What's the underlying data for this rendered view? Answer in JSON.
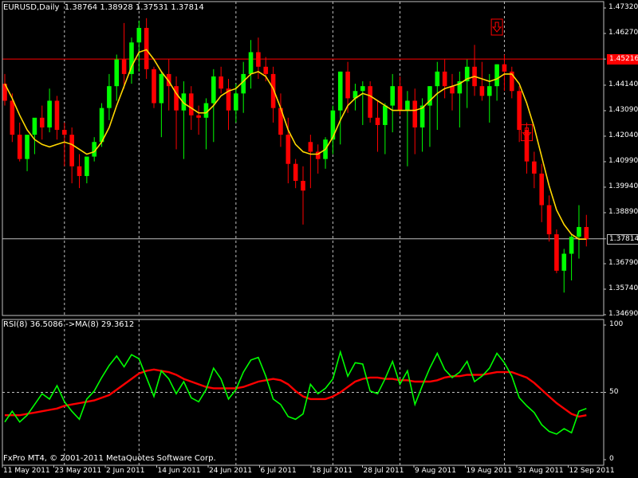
{
  "chart_data": [
    {
      "type": "candlestick",
      "symbol_label": "EURUSD,Daily",
      "ohlc_header": "1.38764 1.38928 1.37531 1.37814",
      "y_ticks": [
        "1.47320",
        "1.46270",
        "1.45216",
        "1.44140",
        "1.43090",
        "1.42040",
        "1.40990",
        "1.39940",
        "1.38890",
        "1.37814",
        "1.36790",
        "1.35740",
        "1.34690"
      ],
      "ylim": [
        1.3469,
        1.4732
      ],
      "horizontal_lines": [
        {
          "price": 1.45216,
          "label": "1.45216",
          "color": "#ff0000"
        },
        {
          "price": 1.37814,
          "label": "1.37814",
          "color": "#c0c0c0"
        }
      ],
      "x_labels": [
        "11 May 2011",
        "23 May 2011",
        "2 Jun 2011",
        "14 Jun 2011",
        "24 Jun 2011",
        "6 Jul 2011",
        "18 Jul 2011",
        "28 Jul 2011",
        "9 Aug 2011",
        "19 Aug 2011",
        "31 Aug 2011",
        "12 Sep 2011"
      ],
      "series": [
        {
          "name": "candles",
          "colors": {
            "up": "#00ff00",
            "down": "#ff0000"
          },
          "open": [
            1.442,
            1.435,
            1.421,
            1.411,
            1.421,
            1.428,
            1.424,
            1.435,
            1.423,
            1.421,
            1.408,
            1.404,
            1.412,
            1.418,
            1.432,
            1.441,
            1.452,
            1.446,
            1.459,
            1.465,
            1.448,
            1.434,
            1.446,
            1.441,
            1.431,
            1.438,
            1.429,
            1.428,
            1.434,
            1.445,
            1.44,
            1.431,
            1.438,
            1.446,
            1.455,
            1.449,
            1.446,
            1.432,
            1.421,
            1.409,
            1.402,
            1.418,
            1.414,
            1.411,
            1.419,
            1.431,
            1.447,
            1.436,
            1.439,
            1.441,
            1.428,
            1.425,
            1.433,
            1.441,
            1.431,
            1.435,
            1.424,
            1.433,
            1.441,
            1.447,
            1.441,
            1.438,
            1.443,
            1.449,
            1.441,
            1.437,
            1.441,
            1.45,
            1.447,
            1.439,
            1.423,
            1.41,
            1.405,
            1.392,
            1.38,
            1.365,
            1.372,
            1.379,
            1.383
          ],
          "high": [
            1.446,
            1.438,
            1.426,
            1.416,
            1.424,
            1.433,
            1.44,
            1.437,
            1.426,
            1.424,
            1.413,
            1.407,
            1.42,
            1.434,
            1.446,
            1.454,
            1.467,
            1.461,
            1.468,
            1.469,
            1.449,
            1.447,
            1.452,
            1.445,
            1.443,
            1.441,
            1.433,
            1.436,
            1.448,
            1.449,
            1.444,
            1.442,
            1.451,
            1.46,
            1.461,
            1.453,
            1.449,
            1.438,
            1.428,
            1.411,
            1.408,
            1.421,
            1.417,
            1.42,
            1.433,
            1.447,
            1.451,
            1.442,
            1.443,
            1.443,
            1.435,
            1.434,
            1.446,
            1.445,
            1.439,
            1.44,
            1.436,
            1.441,
            1.451,
            1.452,
            1.446,
            1.447,
            1.452,
            1.458,
            1.451,
            1.446,
            1.45,
            1.454,
            1.449,
            1.441,
            1.426,
            1.414,
            1.409,
            1.396,
            1.382,
            1.374,
            1.38,
            1.392,
            1.388
          ],
          "low": [
            1.433,
            1.418,
            1.41,
            1.406,
            1.413,
            1.419,
            1.422,
            1.419,
            1.408,
            1.401,
            1.399,
            1.401,
            1.41,
            1.416,
            1.427,
            1.435,
            1.44,
            1.442,
            1.447,
            1.444,
            1.432,
            1.42,
            1.431,
            1.415,
            1.411,
            1.423,
            1.421,
            1.415,
            1.418,
            1.438,
            1.423,
            1.426,
            1.43,
            1.44,
            1.444,
            1.443,
            1.426,
            1.416,
            1.401,
            1.399,
            1.384,
            1.399,
            1.405,
            1.407,
            1.413,
            1.417,
            1.43,
            1.431,
            1.425,
            1.426,
            1.414,
            1.413,
            1.422,
            1.429,
            1.408,
            1.413,
            1.414,
            1.416,
            1.423,
            1.436,
            1.431,
            1.424,
            1.432,
            1.437,
            1.435,
            1.426,
            1.435,
            1.439,
            1.436,
            1.418,
            1.405,
            1.399,
            1.385,
            1.377,
            1.364,
            1.356,
            1.361,
            1.37,
            1.375
          ],
          "close": [
            1.435,
            1.421,
            1.411,
            1.421,
            1.428,
            1.424,
            1.435,
            1.423,
            1.421,
            1.408,
            1.404,
            1.412,
            1.418,
            1.432,
            1.441,
            1.452,
            1.446,
            1.459,
            1.465,
            1.448,
            1.434,
            1.446,
            1.441,
            1.431,
            1.438,
            1.429,
            1.428,
            1.434,
            1.445,
            1.44,
            1.431,
            1.438,
            1.446,
            1.455,
            1.449,
            1.446,
            1.432,
            1.421,
            1.409,
            1.402,
            1.398,
            1.414,
            1.411,
            1.419,
            1.431,
            1.447,
            1.436,
            1.439,
            1.441,
            1.428,
            1.425,
            1.433,
            1.441,
            1.431,
            1.435,
            1.424,
            1.433,
            1.441,
            1.447,
            1.441,
            1.438,
            1.443,
            1.449,
            1.441,
            1.437,
            1.441,
            1.45,
            1.447,
            1.439,
            1.423,
            1.41,
            1.405,
            1.392,
            1.38,
            1.365,
            1.372,
            1.379,
            1.383,
            1.378
          ]
        },
        {
          "name": "moving-average",
          "color": "#ffd700",
          "values": [
            1.442,
            1.436,
            1.429,
            1.423,
            1.419,
            1.417,
            1.416,
            1.417,
            1.418,
            1.417,
            1.415,
            1.413,
            1.414,
            1.418,
            1.424,
            1.433,
            1.441,
            1.449,
            1.455,
            1.456,
            1.452,
            1.447,
            1.443,
            1.438,
            1.434,
            1.432,
            1.43,
            1.43,
            1.433,
            1.437,
            1.439,
            1.44,
            1.443,
            1.446,
            1.447,
            1.445,
            1.44,
            1.432,
            1.423,
            1.417,
            1.414,
            1.413,
            1.413,
            1.415,
            1.42,
            1.427,
            1.433,
            1.436,
            1.438,
            1.437,
            1.435,
            1.433,
            1.431,
            1.431,
            1.431,
            1.431,
            1.432,
            1.435,
            1.438,
            1.44,
            1.441,
            1.442,
            1.444,
            1.445,
            1.444,
            1.443,
            1.444,
            1.446,
            1.446,
            1.442,
            1.434,
            1.424,
            1.412,
            1.4,
            1.39,
            1.384,
            1.38,
            1.378,
            1.378
          ]
        }
      ],
      "arrow_markers": [
        {
          "index": 66,
          "price": 1.465
        },
        {
          "index": 70,
          "price": 1.4215
        }
      ],
      "vertical_separators": [
        8,
        18,
        31,
        44,
        53,
        67
      ]
    },
    {
      "type": "line",
      "header": "RSI(8) 36.5086 ->MA(8) 29.3612",
      "y_ticks": [
        "100",
        "50",
        "0"
      ],
      "ylim": [
        0,
        100
      ],
      "reference_line": 50,
      "series": [
        {
          "name": "RSI(8)",
          "color": "#00ff00",
          "values": [
            28,
            36,
            28,
            33,
            41,
            49,
            45,
            55,
            43,
            36,
            30,
            45,
            51,
            61,
            70,
            77,
            69,
            78,
            75,
            61,
            47,
            66,
            60,
            49,
            58,
            46,
            43,
            52,
            68,
            60,
            45,
            52,
            65,
            74,
            76,
            62,
            45,
            41,
            32,
            30,
            34,
            56,
            49,
            53,
            60,
            80,
            62,
            72,
            71,
            51,
            49,
            60,
            73,
            56,
            66,
            41,
            55,
            68,
            79,
            67,
            61,
            65,
            73,
            58,
            62,
            68,
            79,
            72,
            62,
            46,
            40,
            35,
            26,
            21,
            19,
            23,
            20,
            36,
            38
          ]
        },
        {
          "name": "MA(8)",
          "color": "#ff0000",
          "values": [
            33,
            33,
            33,
            34,
            35,
            36,
            37,
            38,
            40,
            41,
            42,
            43,
            44,
            46,
            48,
            52,
            56,
            60,
            64,
            66,
            67,
            66,
            65,
            63,
            60,
            58,
            56,
            54,
            53,
            53,
            53,
            53,
            54,
            56,
            58,
            59,
            60,
            59,
            56,
            51,
            47,
            45,
            45,
            45,
            47,
            50,
            54,
            58,
            60,
            61,
            61,
            60,
            60,
            59,
            59,
            58,
            58,
            58,
            59,
            61,
            62,
            62,
            63,
            63,
            63,
            64,
            65,
            65,
            65,
            63,
            61,
            57,
            52,
            47,
            42,
            38,
            34,
            32,
            33
          ]
        }
      ],
      "footer": "FxPro MT4, © 2001-2011 MetaQuotes Software Corp."
    }
  ]
}
